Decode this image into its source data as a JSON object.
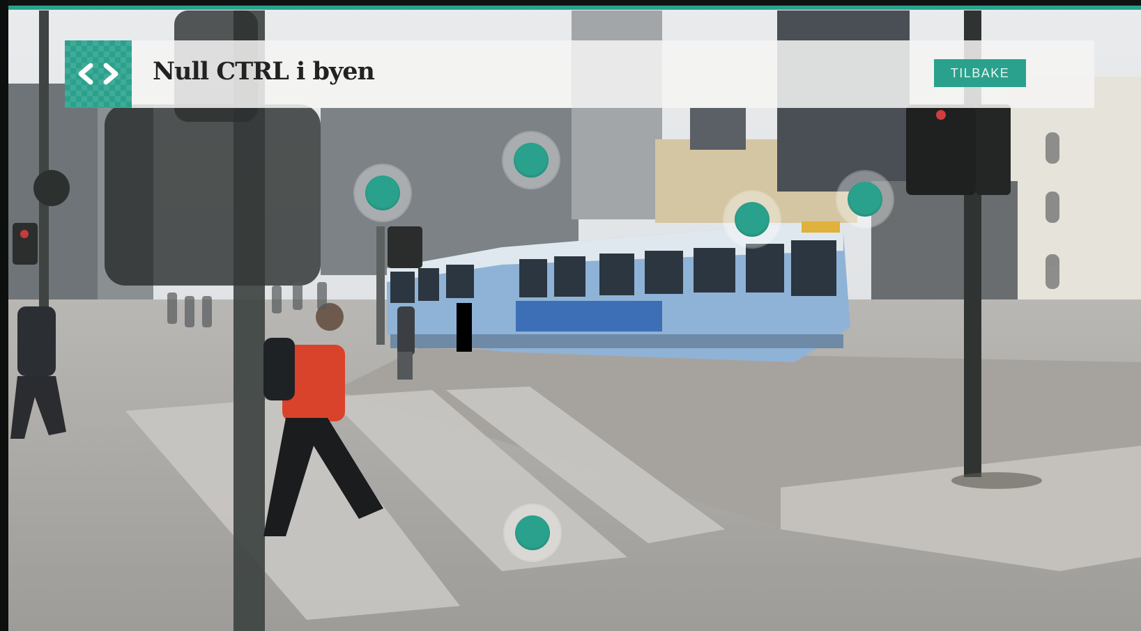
{
  "header": {
    "title": "Null CTRL i byen",
    "back_label": "TILBAKE",
    "logo_icon": "code-brackets-icon"
  },
  "hotspots": [
    {
      "name": "hotspot-building-left",
      "icon": "info-dot-icon"
    },
    {
      "name": "hotspot-tower",
      "icon": "info-dot-icon"
    },
    {
      "name": "hotspot-tram",
      "icon": "info-dot-icon"
    },
    {
      "name": "hotspot-traffic-light",
      "icon": "info-dot-icon"
    },
    {
      "name": "hotspot-crosswalk",
      "icon": "info-dot-icon"
    }
  ],
  "colors": {
    "accent": "#2aa18c",
    "header_bg": "#f5f5f3",
    "title_text": "#222222"
  }
}
